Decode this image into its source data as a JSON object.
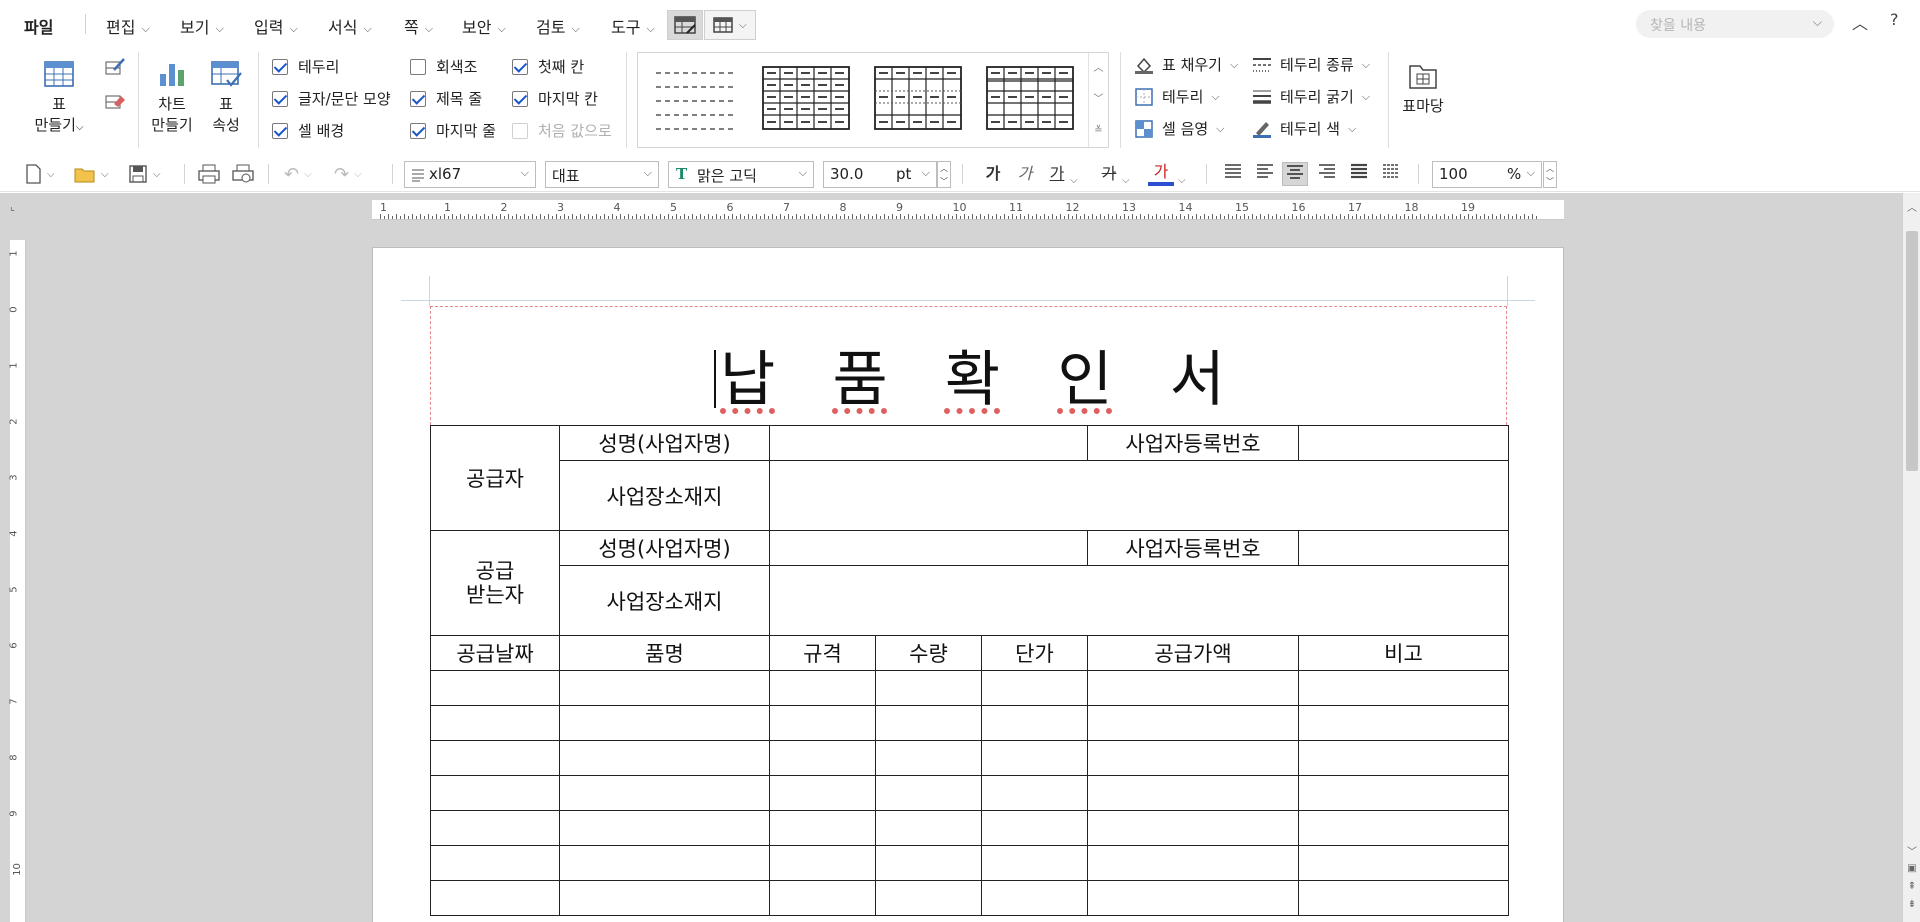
{
  "menubar": {
    "file": "파일",
    "items": [
      "편집",
      "보기",
      "입력",
      "서식",
      "쪽",
      "보안",
      "검토",
      "도구"
    ],
    "search_placeholder": "찾을 내용"
  },
  "ribbon": {
    "table_make": [
      "표",
      "만들기"
    ],
    "chart_make": [
      "차트",
      "만들기"
    ],
    "table_props": [
      "표",
      "속성"
    ],
    "checks": [
      {
        "label": "테두리",
        "checked": true
      },
      {
        "label": "회색조",
        "checked": false
      },
      {
        "label": "첫째 칸",
        "checked": true
      },
      {
        "label": "글자/문단 모양",
        "checked": true
      },
      {
        "label": "제목 줄",
        "checked": true
      },
      {
        "label": "마지막 칸",
        "checked": true
      },
      {
        "label": "셀 배경",
        "checked": true
      },
      {
        "label": "마지막 줄",
        "checked": true
      },
      {
        "label": "처음 값으로",
        "checked": false,
        "disabled": true
      }
    ],
    "cell_fill": "표 채우기",
    "border": "테두리",
    "cell_shade": "셀 음영",
    "border_kind": "테두리 종류",
    "border_thick": "테두리 굵기",
    "border_color": "테두리 색",
    "table_madang": "표마당"
  },
  "toolbar": {
    "style": "xl67",
    "lang": "대표",
    "font": "맑은 고딕",
    "size": "30.0",
    "size_unit": "pt",
    "fmt": [
      "가",
      "가",
      "가",
      "가",
      "가"
    ],
    "zoom": "100",
    "zoom_unit": "%"
  },
  "ruler": {
    "h_numbers": [
      "1",
      "1",
      "2",
      "3",
      "4",
      "5",
      "6",
      "7",
      "8",
      "9",
      "10",
      "11",
      "12",
      "13",
      "14",
      "15",
      "16",
      "17",
      "18",
      "19"
    ],
    "v_numbers": [
      "1",
      "0",
      "1",
      "2",
      "3",
      "4",
      "5",
      "6",
      "7",
      "8",
      "9",
      "10"
    ]
  },
  "document": {
    "title": [
      "납",
      "품",
      "확",
      "인",
      "서"
    ],
    "supplier": "공급자",
    "receiver": [
      "공급",
      "받는자"
    ],
    "name_label": "성명(사업자명)",
    "address_label": "사업장소재지",
    "regno_label": "사업자등록번호",
    "columns": [
      "공급날짜",
      "품명",
      "규격",
      "수량",
      "단가",
      "공급가액",
      "비고"
    ]
  },
  "colors": {
    "accent": "#1a56c9",
    "workspace": "#d4d4d4",
    "title_guide": "#e48a8a"
  }
}
